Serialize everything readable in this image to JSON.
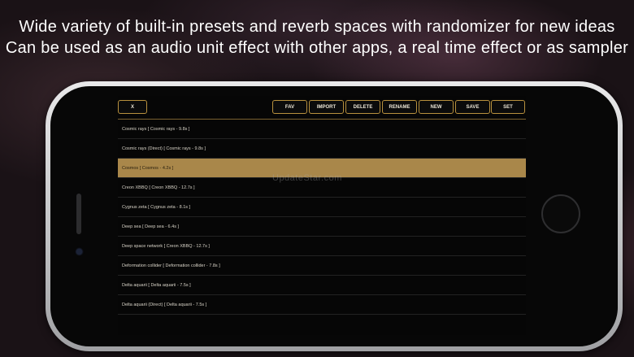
{
  "headline": {
    "line1": "Wide variety of built-in presets and reverb spaces with randomizer for new ideas",
    "line2": "Can be used as an audio unit effect with other apps, a real time effect or as sampler"
  },
  "toolbar": {
    "close_label": "X",
    "fav_label": "FAV",
    "import_label": "IMPORT",
    "delete_label": "DELETE",
    "rename_label": "RENAME",
    "new_label": "NEW",
    "save_label": "SAVE",
    "set_label": "SET"
  },
  "presets": [
    "Cosmic rays [ Cosmic rays - 9.8s ]",
    "Cosmic rays (Direct) [ Cosmic rays - 9.8s ]",
    "Cosmos [ Cosmos - 4.2s ]",
    "Creon XBBQ [ Creon XBBQ - 12.7s ]",
    "Cygnus zeta [ Cygnus zeta - 8.1s ]",
    "Deep sea [ Deep sea - 6.4s ]",
    "Deep space network [ Creon XBBQ - 12.7s ]",
    "Deformation collider [ Deformation collider - 7.8s ]",
    "Delta aquarii [ Delta aquarii - 7.5s ]",
    "Delta aquarii (Direct) [ Delta aquarii - 7.5s ]"
  ],
  "selected_preset_index": 2,
  "watermark": "UpdateStar.com",
  "colors": {
    "accent": "#b8913e",
    "selected_row": "#a9874a",
    "screen_bg": "#060606"
  }
}
